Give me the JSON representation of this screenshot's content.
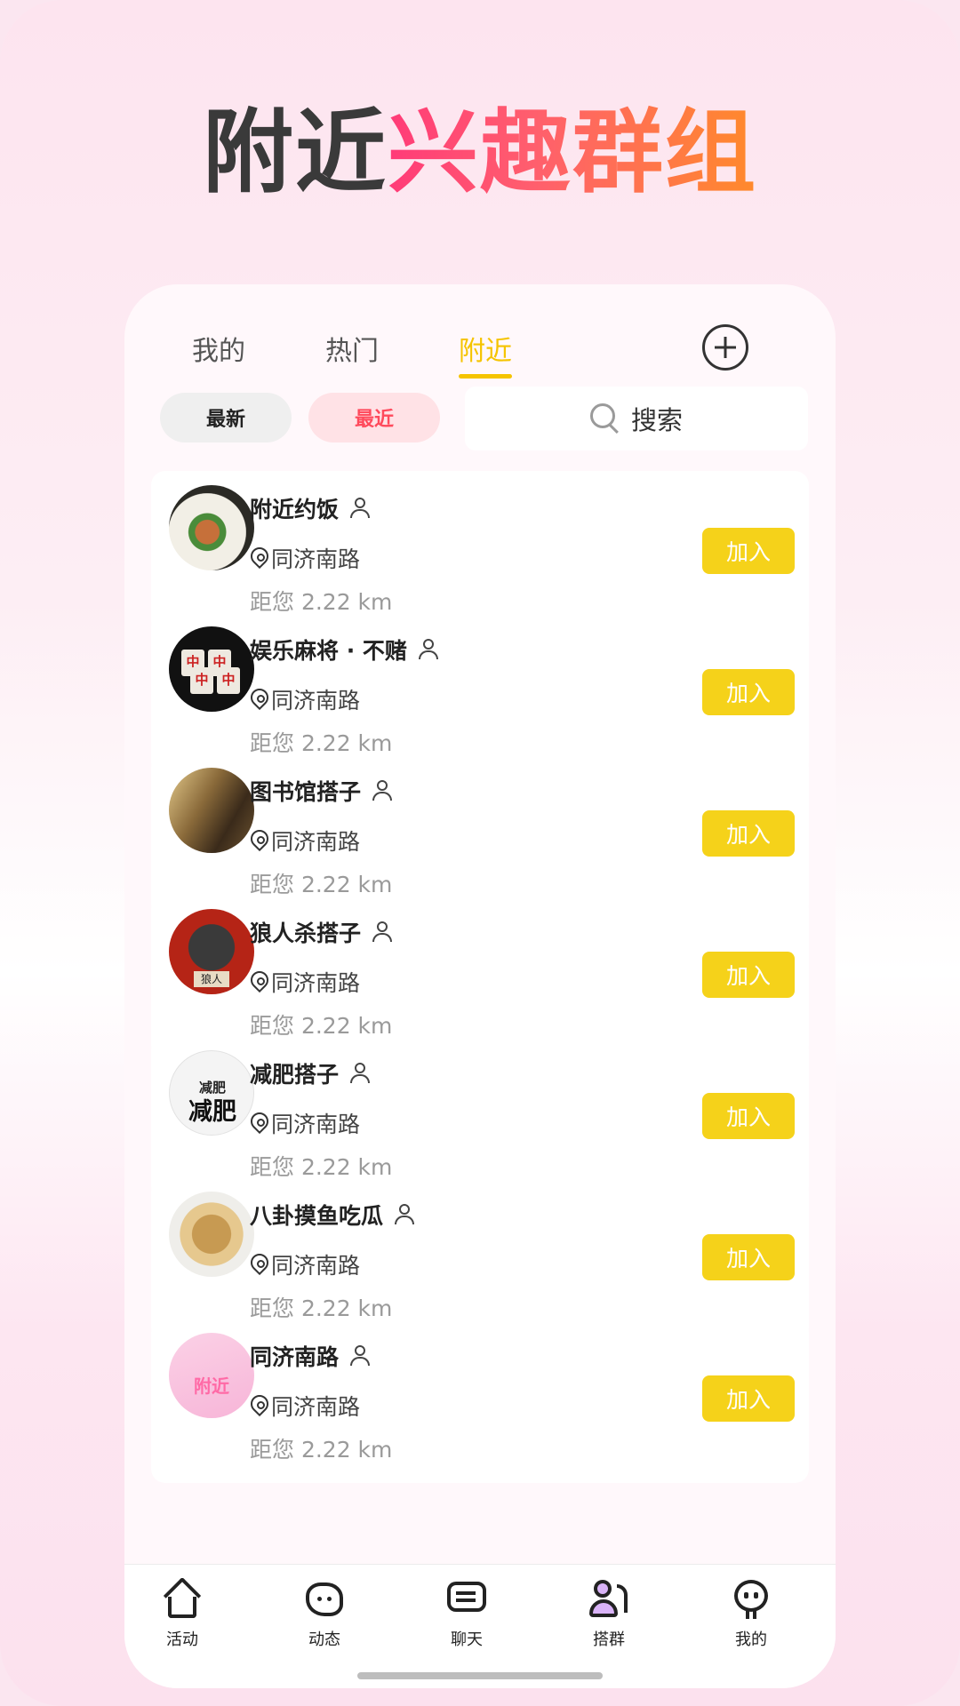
{
  "headline": {
    "part1": "附近",
    "part2": "兴趣群组"
  },
  "tabs": [
    {
      "label": "我的",
      "active": false
    },
    {
      "label": "热门",
      "active": false
    },
    {
      "label": "附近",
      "active": true
    }
  ],
  "filters": {
    "newest": "最新",
    "nearest": "最近"
  },
  "search": {
    "label": "搜索"
  },
  "groups": [
    {
      "name": "附近约饭",
      "location": "同济南路",
      "distance": "距您 2.22 km",
      "join": "加入"
    },
    {
      "name": "娱乐麻将 · 不赌",
      "location": "同济南路",
      "distance": "距您 2.22 km",
      "join": "加入"
    },
    {
      "name": "图书馆搭子",
      "location": "同济南路",
      "distance": "距您 2.22 km",
      "join": "加入"
    },
    {
      "name": "狼人杀搭子",
      "location": "同济南路",
      "distance": "距您 2.22 km",
      "join": "加入",
      "avatar_text": "狼人"
    },
    {
      "name": "减肥搭子",
      "location": "同济南路",
      "distance": "距您 2.22 km",
      "join": "加入",
      "avatar_text_small": "减肥",
      "avatar_text_big": "减肥"
    },
    {
      "name": "八卦摸鱼吃瓜",
      "location": "同济南路",
      "distance": "距您 2.22 km",
      "join": "加入"
    },
    {
      "name": "同济南路",
      "location": "同济南路",
      "distance": "距您 2.22 km",
      "join": "加入",
      "avatar_text": "附近"
    }
  ],
  "bottom_nav": [
    {
      "label": "活动",
      "icon": "home-icon"
    },
    {
      "label": "动态",
      "icon": "feed-icon"
    },
    {
      "label": "聊天",
      "icon": "chat-icon"
    },
    {
      "label": "搭群",
      "icon": "group-icon",
      "active": true
    },
    {
      "label": "我的",
      "icon": "profile-icon"
    }
  ],
  "colors": {
    "accent_yellow": "#f5d21a",
    "tab_active": "#f5c400",
    "pill_near_text": "#ff4a5c",
    "headline_gradient": [
      "#ff3b78",
      "#ff8a2b"
    ]
  }
}
